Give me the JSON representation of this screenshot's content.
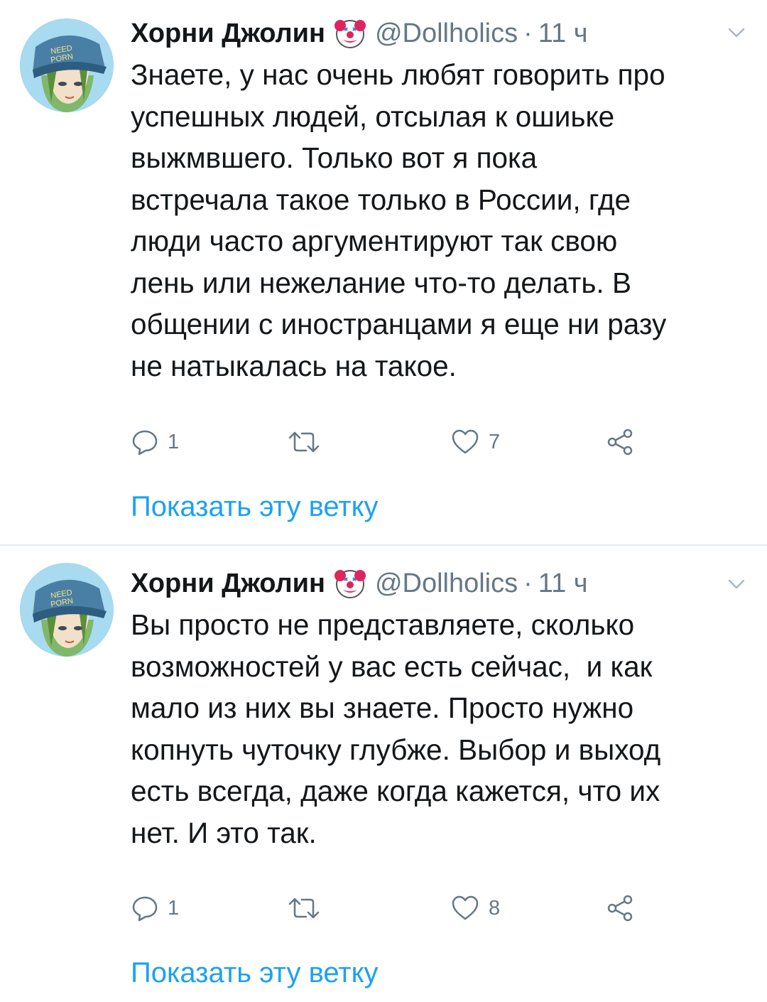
{
  "colors": {
    "text": "#14171a",
    "secondary": "#657786",
    "link": "#1da1f2",
    "divider": "#e6ecf0"
  },
  "tweets": [
    {
      "name": "Хорни Джолин",
      "badge_icon": "clown-face-emoji",
      "handle": "@Dollholics",
      "separator": "·",
      "time": "11 ч",
      "text": "Знаете, у нас очень любят говорить про\nуспешных людей, отсылая к ошиьке\nвыжмвшего. Только вот я пока\nвстречала такое только в России, где\nлюди часто аргументируют так свою\nлень или нежелание что-то делать. В\nобщении с иностранцами я еще ни разу\nне натыкалась на такое.",
      "replies": "1",
      "likes": "7",
      "show_thread": "Показать эту ветку"
    },
    {
      "name": "Хорни Джолин",
      "badge_icon": "clown-face-emoji",
      "handle": "@Dollholics",
      "separator": "·",
      "time": "11 ч",
      "text": "Вы просто не представляете, сколько\nвозможностей у вас есть сейчас,  и как\nмало из них вы знаете. Просто нужно\nкопнуть чуточку глубже. Выбор и выход\nесть всегда, даже когда кажется, что их\nнет. И это так.",
      "replies": "1",
      "likes": "8",
      "show_thread": "Показать эту ветку"
    }
  ]
}
